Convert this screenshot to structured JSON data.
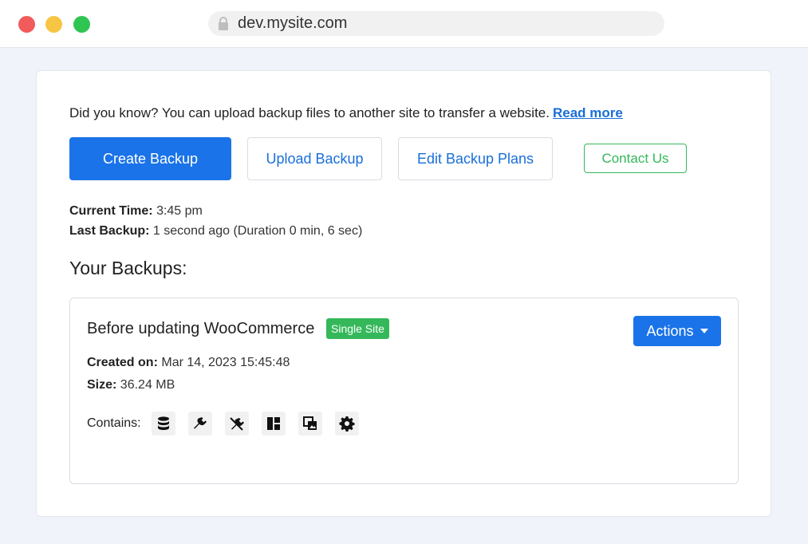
{
  "browser": {
    "url": "dev.mysite.com"
  },
  "tip": {
    "text": "Did you know? You can upload backup files to another site to transfer a website.",
    "link_label": "Read more"
  },
  "toolbar": {
    "create_label": "Create Backup",
    "upload_label": "Upload Backup",
    "plans_label": "Edit Backup Plans",
    "contact_label": "Contact Us"
  },
  "status": {
    "current_time_label": "Current Time:",
    "current_time_value": "3:45 pm",
    "last_backup_label": "Last Backup:",
    "last_backup_value": "1 second ago (Duration 0 min, 6 sec)"
  },
  "backups": {
    "title": "Your Backups:",
    "items": [
      {
        "name": "Before updating WooCommerce",
        "badge": "Single Site",
        "actions_label": "Actions",
        "created_label": "Created on:",
        "created_value": "Mar 14, 2023 15:45:48",
        "size_label": "Size:",
        "size_value": "36.24 MB",
        "contains_label": "Contains:",
        "contains_icons": [
          "database-icon",
          "plugin-icon",
          "plugin-off-icon",
          "layout-icon",
          "media-icon",
          "gear-icon"
        ]
      }
    ]
  },
  "colors": {
    "primary": "#1a73e8",
    "success": "#34b85a",
    "background": "#f0f4fa"
  }
}
